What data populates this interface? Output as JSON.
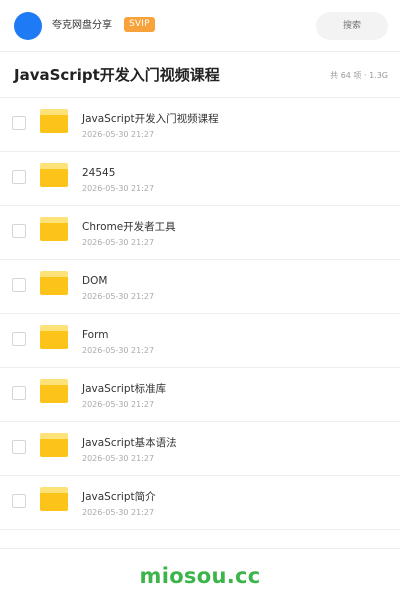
{
  "header": {
    "username": "夸克网盘分享",
    "badge": "SVIP",
    "search_placeholder": "搜索",
    "avatar_color": "#1f7bf5",
    "badge_color": "#f7a23a"
  },
  "folder": {
    "title": "JavaScript开发入门视频课程",
    "meta": "共 64 项 · 1.3G"
  },
  "files": [
    {
      "icon": "folder-icon",
      "name": "JavaScript开发入门视频课程",
      "date": "2026-05-30 21:27"
    },
    {
      "icon": "folder-icon",
      "name": "24545",
      "date": "2026-05-30 21:27"
    },
    {
      "icon": "folder-icon",
      "name": "Chrome开发者工具",
      "date": "2026-05-30 21:27"
    },
    {
      "icon": "folder-icon",
      "name": "DOM",
      "date": "2026-05-30 21:27"
    },
    {
      "icon": "folder-icon",
      "name": "Form",
      "date": "2026-05-30 21:27"
    },
    {
      "icon": "folder-icon",
      "name": "JavaScript标准库",
      "date": "2026-05-30 21:27"
    },
    {
      "icon": "folder-icon",
      "name": "JavaScript基本语法",
      "date": "2026-05-30 21:27"
    },
    {
      "icon": "folder-icon",
      "name": "JavaScript简介",
      "date": "2026-05-30 21:27"
    }
  ],
  "footer": {
    "brand": "miosou.cc",
    "brand_color": "#3bb54a"
  }
}
